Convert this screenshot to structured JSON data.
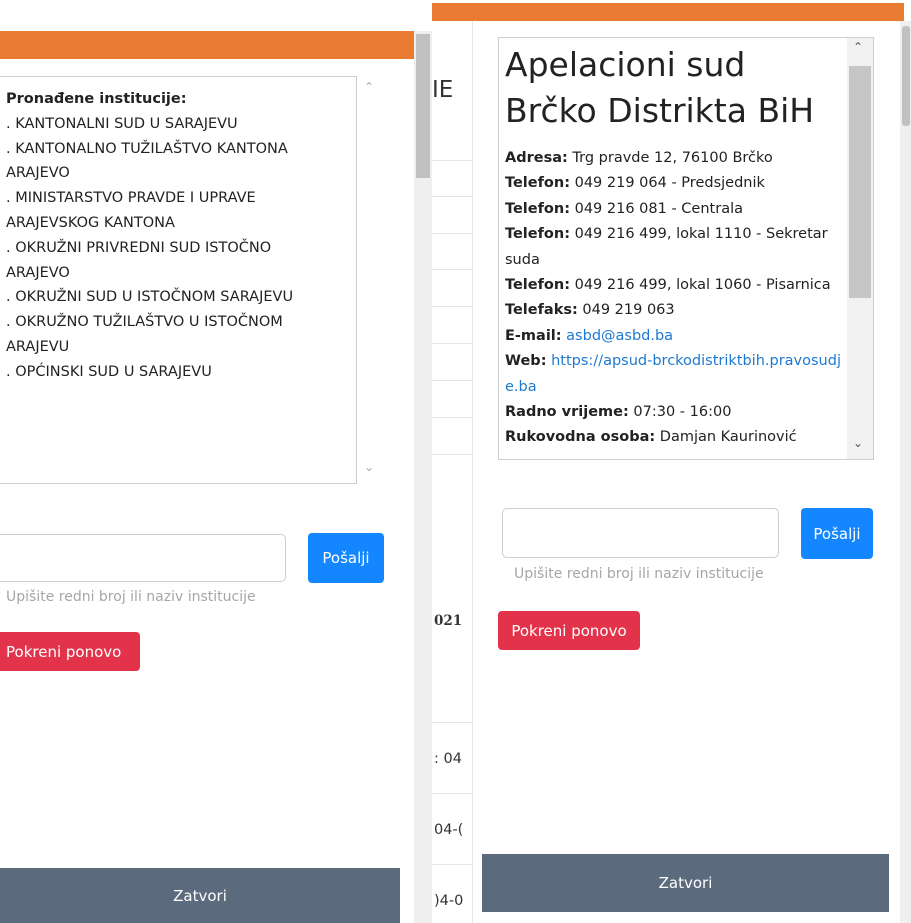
{
  "left_panel": {
    "list_header": "Pronađene institucije:",
    "list_lines": [
      ". KANTONALNI SUD U SARAJEVU",
      ". KANTONALNO TUŽILAŠTVO KANTONA",
      "ARAJEVO",
      ". MINISTARSTVO PRAVDE I UPRAVE",
      "ARAJEVSKOG KANTONA",
      ". OKRUŽNI PRIVREDNI SUD ISTOČNO",
      "ARAJEVO",
      ". OKRUŽNI SUD U ISTOČNOM SARAJEVU",
      ". OKRUŽNO TUŽILAŠTVO U ISTOČNOM",
      "ARAJEVU",
      ". OPĆINSKI SUD U SARAJEVU"
    ],
    "input_value": "",
    "send_label": "Pošalji",
    "hint": "Upišite redni broj ili naziv institucije",
    "restart_label": "Pokreni ponovo",
    "close_label": "Zatvori"
  },
  "background_page": {
    "heading_fragment": "IE",
    "bold_fragment": "021",
    "text_fragments": [
      ": 04",
      "04-(",
      ")4-0"
    ]
  },
  "right_panel": {
    "title": "Apelacioni sud Brčko Distrikta BiH",
    "info": [
      {
        "label": "Adresa:",
        "value": "Trg pravde 12, 76100 Brčko"
      },
      {
        "label": "Telefon:",
        "value": "049 219 064 - Predsjednik"
      },
      {
        "label": "Telefon:",
        "value": "049 216 081 - Centrala"
      },
      {
        "label": "Telefon:",
        "value": "049 216 499, lokal 1110 - Sekretar suda"
      },
      {
        "label": "Telefon:",
        "value": "049 216 499, lokal 1060 - Pisarnica"
      },
      {
        "label": "Telefaks:",
        "value": "049 219 063"
      },
      {
        "label": "E-mail:",
        "link": "asbd@asbd.ba"
      },
      {
        "label": "Web:",
        "link": "https://apsud-brckodistriktbih.pravosudje.ba"
      },
      {
        "label": "Radno vrijeme:",
        "value": "07:30 - 16:00"
      },
      {
        "label": "Rukovodna osoba:",
        "value": "Damjan Kaurinović"
      }
    ],
    "input_value": "",
    "send_label": "Pošalji",
    "hint": "Upišite redni broj ili naziv institucije",
    "restart_label": "Pokreni ponovo",
    "close_label": "Zatvori"
  },
  "colors": {
    "header_bar": "#ea7b33",
    "primary_button": "#1486ff",
    "danger_button": "#e3334b",
    "close_bar": "#5c6a7d",
    "link": "#1f78d1"
  },
  "icons": [
    "chevron-up-icon",
    "chevron-down-icon"
  ]
}
